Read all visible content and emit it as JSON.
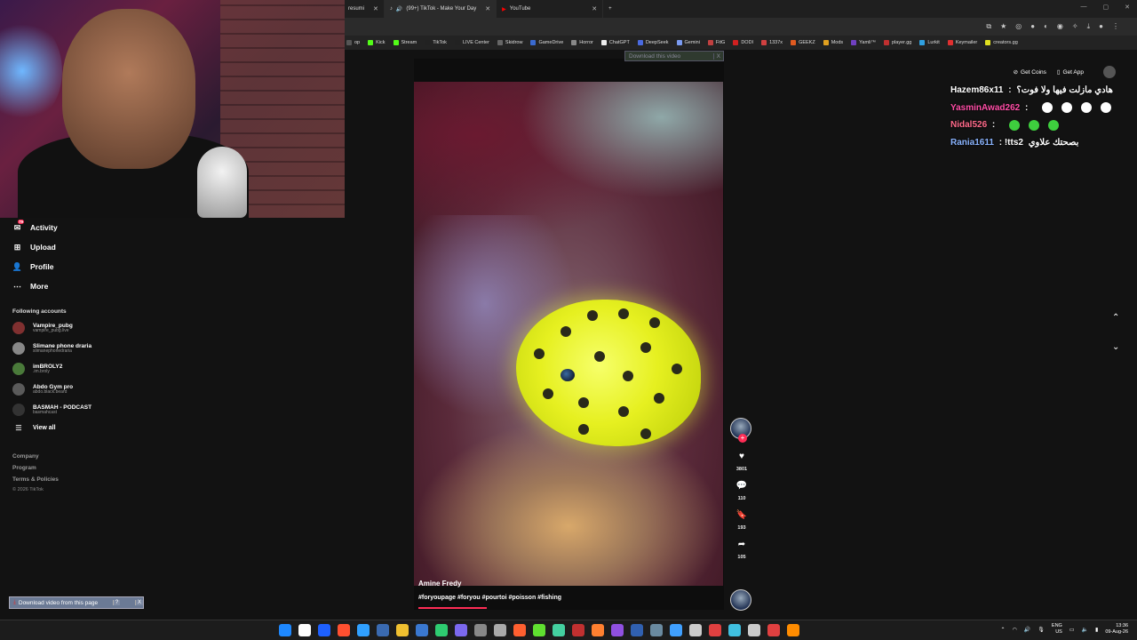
{
  "browser": {
    "tabs": [
      {
        "label": "resumi",
        "active": false
      },
      {
        "label": "(99+) TikTok - Make Your Day",
        "active": true
      },
      {
        "label": "YouTube",
        "active": false
      }
    ],
    "new_tab_label": "+",
    "bookmarks": [
      {
        "label": "op",
        "color": "#555"
      },
      {
        "label": "Kick",
        "color": "#53fc18"
      },
      {
        "label": "Stream",
        "color": "#53fc18"
      },
      {
        "label": "TikTok",
        "color": "#222"
      },
      {
        "label": "LIVE Center",
        "color": "#222"
      },
      {
        "label": "Skidrow",
        "color": "#666"
      },
      {
        "label": "GameDrive",
        "color": "#3a6ad0"
      },
      {
        "label": "Horror",
        "color": "#888"
      },
      {
        "label": "ChatGPT",
        "color": "#eee"
      },
      {
        "label": "DeepSeek",
        "color": "#4a6ae0"
      },
      {
        "label": "Gemini",
        "color": "#7a9af0"
      },
      {
        "label": "FitG",
        "color": "#c04040"
      },
      {
        "label": "DODI",
        "color": "#d02020"
      },
      {
        "label": "1337x",
        "color": "#d04040"
      },
      {
        "label": "GEEKZ",
        "color": "#e05a20"
      },
      {
        "label": "Mods",
        "color": "#e0a020"
      },
      {
        "label": "Yamli™",
        "color": "#7040c0"
      },
      {
        "label": "player.gg",
        "color": "#c03030"
      },
      {
        "label": "Lurkit",
        "color": "#30a0e0"
      },
      {
        "label": "Keymailer",
        "color": "#e03030"
      },
      {
        "label": "creators.gg",
        "color": "#e0e020"
      }
    ]
  },
  "sidebar": {
    "items": [
      {
        "label": "Activity",
        "icon": "activity-icon",
        "glyph": "✉",
        "badge": "79"
      },
      {
        "label": "Upload",
        "icon": "upload-icon",
        "glyph": "⊞"
      },
      {
        "label": "Profile",
        "icon": "profile-icon",
        "glyph": "👤"
      },
      {
        "label": "More",
        "icon": "more-icon",
        "glyph": "⋯"
      }
    ],
    "following_title": "Following accounts",
    "accounts": [
      {
        "name": "Vampire_pubg",
        "handle": "vampire_pubg.live",
        "color": "#803030"
      },
      {
        "name": "Slimane phone draria",
        "handle": "slimanephonedraria",
        "color": "#888"
      },
      {
        "name": "imBROLY2",
        "handle": ".im.broly",
        "color": "#4a7a3a"
      },
      {
        "name": "Abdo Gym pro",
        "handle": "abdo.black.beard",
        "color": "#5a5a5a"
      },
      {
        "name": "BASMAH - PODCAST",
        "handle": "basmahcast",
        "color": "#333"
      }
    ],
    "view_all": "View all",
    "footer": [
      "Company",
      "Program",
      "Terms & Policies"
    ],
    "copyright": "© 2026 TikTok"
  },
  "download_top": {
    "label": "Download this video",
    "close": "X"
  },
  "download_bottom": {
    "label": "Download video from this page",
    "help": "?",
    "close": "X"
  },
  "video": {
    "author": "Amine Fredy",
    "tags": "#foryoupage #foryou #pourtoi #poisson #fishing",
    "progress_fraction": 0.22
  },
  "actions": {
    "likes": "3801",
    "comments": "110",
    "saves": "193",
    "shares": "105"
  },
  "header_buttons": {
    "coins": "Get Coins",
    "app": "Get App"
  },
  "chat": [
    {
      "user": "Hazem86x11",
      "sep": " : ",
      "text": "هادي مازلت فيها ولا فوت؟",
      "color": "#ffffff",
      "emojis": []
    },
    {
      "user": "YasminAwad262",
      "sep": " : ",
      "text": "",
      "color": "#ff4da6",
      "emojis": [
        "#ffffff",
        "#ffffff",
        "#ffffff",
        "#ffffff"
      ]
    },
    {
      "user": "Nidal526",
      "sep": " : ",
      "text": "",
      "color": "#ff6a8a",
      "emojis": [
        "#3ecf3e",
        "#3ecf3e",
        "#3ecf3e"
      ]
    },
    {
      "user": "Rania1611",
      "sep": " : !tts2 ",
      "text": "بصحتك علاوي",
      "color": "#8ab4ff",
      "emojis": []
    }
  ],
  "taskbar": {
    "icons": [
      "#1e88ff",
      "#ffffff",
      "#1e60ff",
      "#ff5030",
      "#30a0ff",
      "#3a6ab0",
      "#f0c030",
      "#3a78d0",
      "#2ecc71",
      "#7b68ee",
      "#888888",
      "#aaaaaa",
      "#ff6030",
      "#60e030",
      "#44d0a0",
      "#c03030",
      "#ff8030",
      "#9050e0",
      "#3060b0",
      "#6a8aa0",
      "#40a0ff",
      "#cccccc",
      "#e04040",
      "#40c0e0",
      "#cccccc",
      "#e04040",
      "#ff8c00"
    ],
    "language": "ENG",
    "region": "US",
    "time": "13:36",
    "date": "09-Aug-26"
  }
}
